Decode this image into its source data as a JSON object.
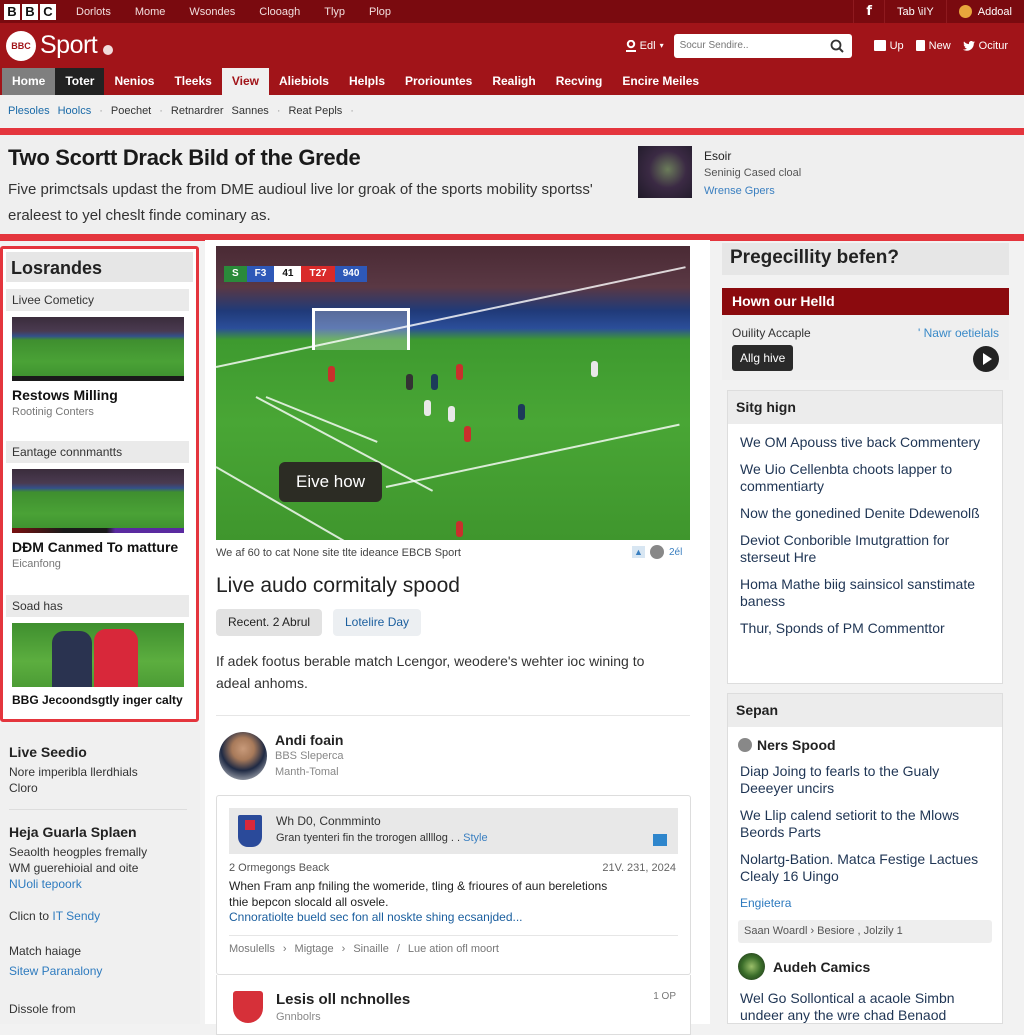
{
  "topbar": {
    "logo": [
      "B",
      "B",
      "C"
    ],
    "links": [
      "Dorlots",
      "Mome",
      "Wsondes",
      "Clooagh",
      "Tlyp",
      "Plop"
    ],
    "facebook_icon": "f",
    "tab_label": "Tab \\iIY",
    "account_label": "Addoal"
  },
  "header": {
    "brand": "Sport",
    "badge_text": "BBC",
    "account_label": "Edl",
    "search_placeholder": "Socur Sendire..",
    "buttons": [
      {
        "icon": "upload-icon",
        "label": "Up"
      },
      {
        "icon": "document-icon",
        "label": "New"
      },
      {
        "icon": "twitter-icon",
        "label": "Ocitur"
      }
    ]
  },
  "nav": {
    "tabs": [
      "Home",
      "Toter",
      "Nenios",
      "Tleeks",
      "View",
      "Aliebiols",
      "Helpls",
      "Proriountes",
      "Realigh",
      "Recving",
      "Encire Meiles"
    ],
    "active_index": 4
  },
  "breadcrumbs": [
    "Plesoles",
    "Hoolcs",
    "Poechet",
    "Retnardrer",
    "Sannes",
    "Reat Pepls"
  ],
  "hero": {
    "title": "Two Scortt Drack Bild of the Grede",
    "summary": "Five primctsals updast the from DME audioul live lor groak of the sports mobility sportss' eraleest to yel cheslt finde cominary as.",
    "side": {
      "name": "Esoir",
      "subtitle": "Seninig Cased cloal",
      "link": "Wrense Gpers"
    }
  },
  "left_sidebar": {
    "title": "Losrandes",
    "cards": [
      {
        "label": "Livee Cometicy",
        "headline": "Restows Milling",
        "sub": "Rootinig Conters"
      },
      {
        "label": "Eantage connmantts",
        "headline": "DĐM Canmed To matture",
        "sub": "Eicanfong"
      },
      {
        "label": "Soad has",
        "headline": "BBG Jecoondsgtly inger calty",
        "sub": ""
      }
    ],
    "lower": [
      {
        "heading": "Live Seedio",
        "lines": [
          "Nore imperibla llerdhials",
          "Cloro"
        ]
      },
      {
        "heading": "Heja Guarla Splaen",
        "lines": [
          "Seaolth heogples fremally",
          "WM guerehioial and oite"
        ],
        "link": "NUoli tepoork"
      },
      {
        "text": "Clicn to",
        "link": "IT Sendy"
      },
      {
        "text": "Match haiage",
        "link": "Sitew Paranalony"
      },
      {
        "text": "Dissole from"
      }
    ]
  },
  "main": {
    "scoreboard": [
      "S",
      "F3",
      "41",
      "T27",
      "940"
    ],
    "overlay_button": "Eive how",
    "caption": "We af 60 to cat None site tlte ideance EBCB Sport",
    "caption_count": "2él",
    "title": "Live audo cormitaly spood",
    "pills": [
      "Recent. 2 Abrul",
      "Lotelire Day"
    ],
    "description": "If adek footus berable match Lcengor, weodere's wehter ioc wining to adeal anhoms.",
    "author": {
      "name": "Andi foain",
      "role": "BBS Sleperca",
      "tag": "Manth-Tomal"
    },
    "comment": {
      "quote_title": "Wh D0, Conmminto",
      "quote_text": "Gran tyenteri fin the trorogen allllog . .",
      "quote_link": "Style",
      "byline": "2 Ormegongs Beack",
      "date": "21V. 231, 2024",
      "body": "When Fram anp fniling the womeride,  tling & frioures of aun bereletions thie bepcon slocald all osvele.",
      "more": "Cnnoratiolte bueld sec fon all noskte shing ecsanjded...",
      "tags": [
        "Mosulells",
        "Migtage",
        "Sinaille",
        "Lue ation ofl moort"
      ]
    },
    "next": {
      "title": "Lesis oll nchnolles",
      "sub": "Gnnbolrs",
      "count": "1 OP"
    }
  },
  "right": {
    "heading": "Pregecillity befen?",
    "box": {
      "title": "Hown our Helld",
      "quality": "Ouility Accaple",
      "link": "' Nawr oetielals",
      "button": "Allg hive"
    },
    "panel1": {
      "title": "Sitg hign",
      "items": [
        "We OM Apouss tive back Commentery",
        "We Uio Cellenbta choots lapper to commentiarty",
        "Now the gonedined Denite Ddewenolß",
        "Deviot Conborible Imutgrattion for sterseut Hre",
        "Homa Mathe biig sainsicol sanstimate baness",
        "Thur, Sponds of PM Commenttor"
      ]
    },
    "panel2": {
      "title": "Sepan",
      "subhead": "Ners Spood",
      "items": [
        "Diap Joing to fearls to the Gualy Deeeyer uncirs",
        "We Llip calend setiorit to the Mlows Beords Parts",
        "Nolartg-Bation. Matca Festige Lactues Clealy 16 Uingo"
      ],
      "link": "Engietera",
      "breadcrumb": "Saan Woardl  ›  Besiore , Jolzily 1",
      "author": "Audeh Camics",
      "author_text": "Wel Go Sollontical a acaole Simbn undeer any the wre chad Benaod"
    }
  }
}
